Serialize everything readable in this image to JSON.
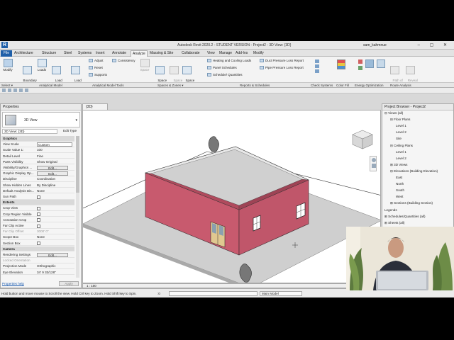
{
  "titlebar": {
    "logo": "R",
    "title": "Autodesk Revit 2020.2 - STUDENT VERSION -  Project2 - 3D View: {3D}",
    "user": "sam_kahmnue"
  },
  "tabs": [
    "File",
    "Architecture",
    "Structure",
    "Steel",
    "Systems",
    "Insert",
    "Annotate",
    "Analyze",
    "Massing & Site",
    "Collaborate",
    "View",
    "Manage",
    "Add-Ins",
    "Modify"
  ],
  "active_tab": "Analyze",
  "ribbon": {
    "modify": "Modify",
    "boundary_conditions": "Boundary\nConditions",
    "loads": "Loads",
    "load_cases": "Load\nCases",
    "load_combinations": "Load\nCombinations",
    "adjust": "Adjust",
    "reset": "Reset",
    "supports": "Supports",
    "consistency": "Consistency",
    "space": "Space",
    "space_separator": "Space\nSeparator",
    "space_tag": "Space\nTag",
    "space_naming": "Space\nNaming",
    "heating_cooling": "Heating and  Cooling Loads",
    "panel_schedules": "Panel  Schedules",
    "schedule_quantities": "Schedule/  Quantities",
    "duct_pressure": "Duct Pressure  Loss Report",
    "pipe_pressure": "Pipe Pressure  Loss Report",
    "path_of_travel": "Path of\nTravel",
    "reveal_obstacles": "Reveal\nObstacles"
  },
  "groups": [
    "Select ▾",
    "Analytical Model",
    "Analytical Model Tools",
    "Spaces & Zones ▾",
    "Reports & Schedules",
    "Check Systems",
    "Color Fill",
    "Energy Optimization",
    "Route Analysis"
  ],
  "properties": {
    "header": "Properties",
    "type_name": "3D View",
    "selector": "3D View: {3D}",
    "edit_type": "Edit Type",
    "rows": [
      {
        "k": "Graphics",
        "v": "",
        "kind": "cat"
      },
      {
        "k": "View Scale",
        "v": "Custom",
        "kind": "box"
      },
      {
        "k": "Scale Value    1:",
        "v": "100",
        "kind": "text"
      },
      {
        "k": "Detail Level",
        "v": "Fine",
        "kind": "text"
      },
      {
        "k": "Parts Visibility",
        "v": "Show Original",
        "kind": "text"
      },
      {
        "k": "Visibility/Graphics ...",
        "v": "Edit...",
        "kind": "btn"
      },
      {
        "k": "Graphic Display Op...",
        "v": "Edit...",
        "kind": "btn"
      },
      {
        "k": "Discipline",
        "v": "Coordination",
        "kind": "text"
      },
      {
        "k": "Show Hidden Lines",
        "v": "By Discipline",
        "kind": "text"
      },
      {
        "k": "Default Analysis Dis...",
        "v": "None",
        "kind": "text"
      },
      {
        "k": "Sun Path",
        "v": "",
        "kind": "cb"
      },
      {
        "k": "Extents",
        "v": "",
        "kind": "cat"
      },
      {
        "k": "Crop View",
        "v": "",
        "kind": "cb"
      },
      {
        "k": "Crop Region Visible",
        "v": "",
        "kind": "cb"
      },
      {
        "k": "Annotation Crop",
        "v": "",
        "kind": "cb"
      },
      {
        "k": "Far Clip Active",
        "v": "",
        "kind": "cb"
      },
      {
        "k": "Far Clip Offset",
        "v": "3000' 0\"",
        "kind": "dim"
      },
      {
        "k": "Scope Box",
        "v": "None",
        "kind": "text"
      },
      {
        "k": "Section Box",
        "v": "",
        "kind": "cb"
      },
      {
        "k": "Camera",
        "v": "",
        "kind": "cat"
      },
      {
        "k": "Rendering Settings",
        "v": "Edit...",
        "kind": "btn"
      },
      {
        "k": "Locked Orientation",
        "v": "",
        "kind": "dim"
      },
      {
        "k": "Projection Mode",
        "v": "Orthographic",
        "kind": "text"
      },
      {
        "k": "Eye Elevation",
        "v": "34'  9 33/128\"",
        "kind": "text"
      }
    ],
    "help": "Properties help",
    "apply": "Apply"
  },
  "view": {
    "tab": "{3D}",
    "scale": "1 : 100"
  },
  "browser": {
    "header": "Project Browser - Project2",
    "items": [
      {
        "label": "Views (all)",
        "indent": 0,
        "exp": "⊟"
      },
      {
        "label": "Floor Plans",
        "indent": 1,
        "exp": "⊟"
      },
      {
        "label": "Level 1",
        "indent": 2,
        "exp": ""
      },
      {
        "label": "Level 2",
        "indent": 2,
        "exp": ""
      },
      {
        "label": "Site",
        "indent": 2,
        "exp": ""
      },
      {
        "label": "Ceiling Plans",
        "indent": 1,
        "exp": "⊟"
      },
      {
        "label": "Level 1",
        "indent": 2,
        "exp": ""
      },
      {
        "label": "Level 2",
        "indent": 2,
        "exp": ""
      },
      {
        "label": "3D Views",
        "indent": 1,
        "exp": "⊞"
      },
      {
        "label": "Elevations (Building Elevation)",
        "indent": 1,
        "exp": "⊟"
      },
      {
        "label": "East",
        "indent": 2,
        "exp": ""
      },
      {
        "label": "North",
        "indent": 2,
        "exp": ""
      },
      {
        "label": "South",
        "indent": 2,
        "exp": ""
      },
      {
        "label": "West",
        "indent": 2,
        "exp": ""
      },
      {
        "label": "Sections (Building Section)",
        "indent": 1,
        "exp": "⊞"
      },
      {
        "label": "Legends",
        "indent": 0,
        "exp": ""
      },
      {
        "label": "Schedules/Quantities (all)",
        "indent": 0,
        "exp": "⊞"
      },
      {
        "label": "Sheets (all)",
        "indent": 0,
        "exp": "⊞"
      },
      {
        "label": "Families",
        "indent": 0,
        "exp": "⊞"
      },
      {
        "label": "Groups",
        "indent": 0,
        "exp": "⊞"
      },
      {
        "label": "Revit Links",
        "indent": 0,
        "exp": ""
      }
    ]
  },
  "status": {
    "message": "Hold button and move mouse to Scroll the view. Hold Ctrl key to Zoom. Hold Shift key to Spin.",
    "model": "Main Model",
    "zero": ":0"
  },
  "colors": {
    "wall": "#c85a6e",
    "wall_dark": "#a94459",
    "ground": "#c8c8c8",
    "ribbon_accent": "#1f5fa8"
  }
}
